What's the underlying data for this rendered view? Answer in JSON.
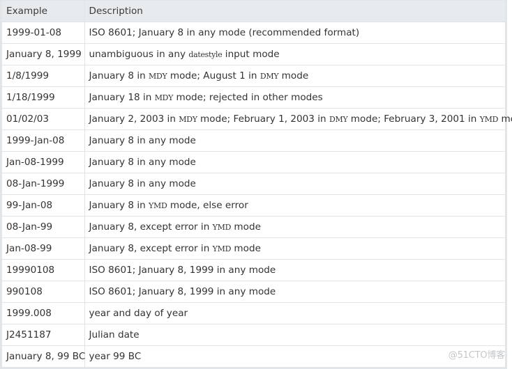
{
  "table": {
    "headers": [
      "Example",
      "Description"
    ],
    "rows": [
      {
        "example": "1999-01-08",
        "description": [
          {
            "t": "ISO 8601; January 8 in any mode (recommended format)"
          }
        ]
      },
      {
        "example": "January 8, 1999",
        "description": [
          {
            "t": "unambiguous in any "
          },
          {
            "code": "datestyle"
          },
          {
            "t": " input mode"
          }
        ]
      },
      {
        "example": "1/8/1999",
        "description": [
          {
            "t": "January 8 in "
          },
          {
            "code": "MDY"
          },
          {
            "t": " mode; August 1 in "
          },
          {
            "code": "DMY"
          },
          {
            "t": " mode"
          }
        ]
      },
      {
        "example": "1/18/1999",
        "description": [
          {
            "t": "January 18 in "
          },
          {
            "code": "MDY"
          },
          {
            "t": " mode; rejected in other modes"
          }
        ]
      },
      {
        "example": "01/02/03",
        "description": [
          {
            "t": "January 2, 2003 in "
          },
          {
            "code": "MDY"
          },
          {
            "t": " mode; February 1, 2003 in "
          },
          {
            "code": "DMY"
          },
          {
            "t": " mode; February 3, 2001 in "
          },
          {
            "code": "YMD"
          },
          {
            "t": " mode"
          }
        ]
      },
      {
        "example": "1999-Jan-08",
        "description": [
          {
            "t": "January 8 in any mode"
          }
        ]
      },
      {
        "example": "Jan-08-1999",
        "description": [
          {
            "t": "January 8 in any mode"
          }
        ]
      },
      {
        "example": "08-Jan-1999",
        "description": [
          {
            "t": "January 8 in any mode"
          }
        ]
      },
      {
        "example": "99-Jan-08",
        "description": [
          {
            "t": "January 8 in "
          },
          {
            "code": "YMD"
          },
          {
            "t": " mode, else error"
          }
        ]
      },
      {
        "example": "08-Jan-99",
        "description": [
          {
            "t": "January 8, except error in "
          },
          {
            "code": "YMD"
          },
          {
            "t": " mode"
          }
        ]
      },
      {
        "example": "Jan-08-99",
        "description": [
          {
            "t": "January 8, except error in "
          },
          {
            "code": "YMD"
          },
          {
            "t": " mode"
          }
        ]
      },
      {
        "example": "19990108",
        "description": [
          {
            "t": "ISO 8601; January 8, 1999 in any mode"
          }
        ]
      },
      {
        "example": "990108",
        "description": [
          {
            "t": "ISO 8601; January 8, 1999 in any mode"
          }
        ]
      },
      {
        "example": "1999.008",
        "description": [
          {
            "t": "year and day of year"
          }
        ]
      },
      {
        "example": "J2451187",
        "description": [
          {
            "t": "Julian date"
          }
        ]
      },
      {
        "example": "January 8, 99 BC",
        "description": [
          {
            "t": "year 99 BC"
          }
        ]
      }
    ]
  },
  "watermark": "@51CTO博客",
  "colors": {
    "header_bg": "#e8ebee",
    "border": "#e1e4e7",
    "text": "#333333",
    "watermark": "#c4c7ca"
  }
}
